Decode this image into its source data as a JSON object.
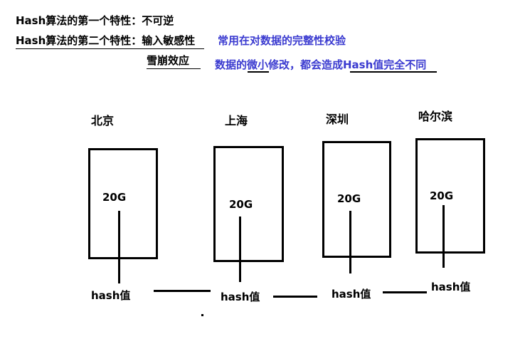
{
  "header": {
    "property1": "Hash算法的第一个特性：不可逆",
    "property2": "Hash算法的第二个特性：输入敏感性",
    "use_case": "常用在对数据的完整性校验",
    "avalanche_label": "雪崩效应",
    "avalanche_desc": "数据的微小修改，都会造成Hash值完全不同"
  },
  "nodes": [
    {
      "city": "北京",
      "size": "20G",
      "hash_label": "hash值"
    },
    {
      "city": "上海",
      "size": "20G",
      "hash_label": "hash值"
    },
    {
      "city": "深圳",
      "size": "20G",
      "hash_label": "hash值"
    },
    {
      "city": "哈尔滨",
      "size": "20G",
      "hash_label": "hash值"
    }
  ],
  "colors": {
    "accent_blue": "#3b3bd0",
    "ink": "#000000"
  }
}
